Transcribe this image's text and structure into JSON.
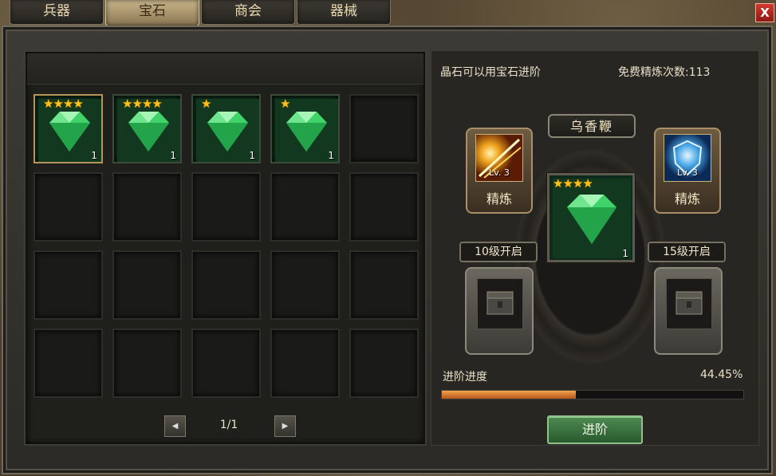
{
  "tabs": [
    {
      "label": "兵器",
      "active": false
    },
    {
      "label": "宝石",
      "active": true
    },
    {
      "label": "商会",
      "active": false
    },
    {
      "label": "器械",
      "active": false
    }
  ],
  "close_label": "X",
  "inventory": {
    "items": [
      {
        "stars": "★★★★",
        "count": "1",
        "selected": true
      },
      {
        "stars": "★★★★",
        "count": "1",
        "selected": false
      },
      {
        "stars": "★",
        "count": "1",
        "selected": false
      },
      {
        "stars": "★",
        "count": "1",
        "selected": false
      }
    ],
    "empty_slots": 16,
    "page": "1/1"
  },
  "info": {
    "hint": "晶石可以用宝石进阶",
    "free_refine_label": "免费精炼次数:",
    "free_refine_count": "113"
  },
  "weapon_name": "乌香鞭",
  "center_gem": {
    "stars": "★★★★",
    "count": "1"
  },
  "skills": [
    {
      "level": "Lv. 3",
      "label": "精炼",
      "icon": "fire-slash-icon"
    },
    {
      "level": "Lv. 3",
      "label": "精炼",
      "icon": "ice-shield-icon"
    }
  ],
  "unlocks": [
    {
      "label": "10级开启"
    },
    {
      "label": "15级开启"
    }
  ],
  "progress": {
    "label": "进阶进度",
    "percent_text": "44.45%",
    "value": 44.45
  },
  "advance_button": "进阶",
  "colors": {
    "progress": "#e08a34",
    "star": "#ffc21a",
    "gem": "#3fd36a"
  }
}
